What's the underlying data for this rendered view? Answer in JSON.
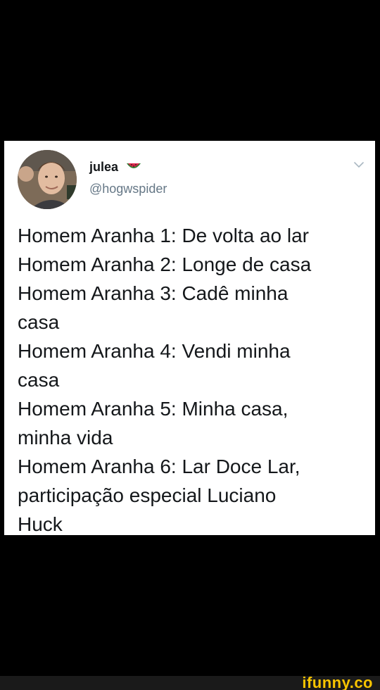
{
  "tweet": {
    "author_name": "julea",
    "author_handle": "@hogwspider",
    "author_emoji": "watermelon-icon",
    "lines": [
      "Homem Aranha 1: De volta ao lar",
      "Homem Aranha 2: Longe de casa",
      "Homem Aranha 3: Cadê minha",
      "casa",
      "Homem Aranha 4: Vendi minha",
      "casa",
      "Homem Aranha 5: Minha casa,",
      "minha vida",
      "Homem Aranha 6: Lar Doce Lar,",
      "participação especial Luciano",
      "Huck"
    ]
  },
  "watermark": {
    "text": "ifunny.co"
  },
  "colors": {
    "background": "#000000",
    "card": "#ffffff",
    "name": "#14171a",
    "handle": "#657786",
    "watermark": "#f8c400"
  }
}
